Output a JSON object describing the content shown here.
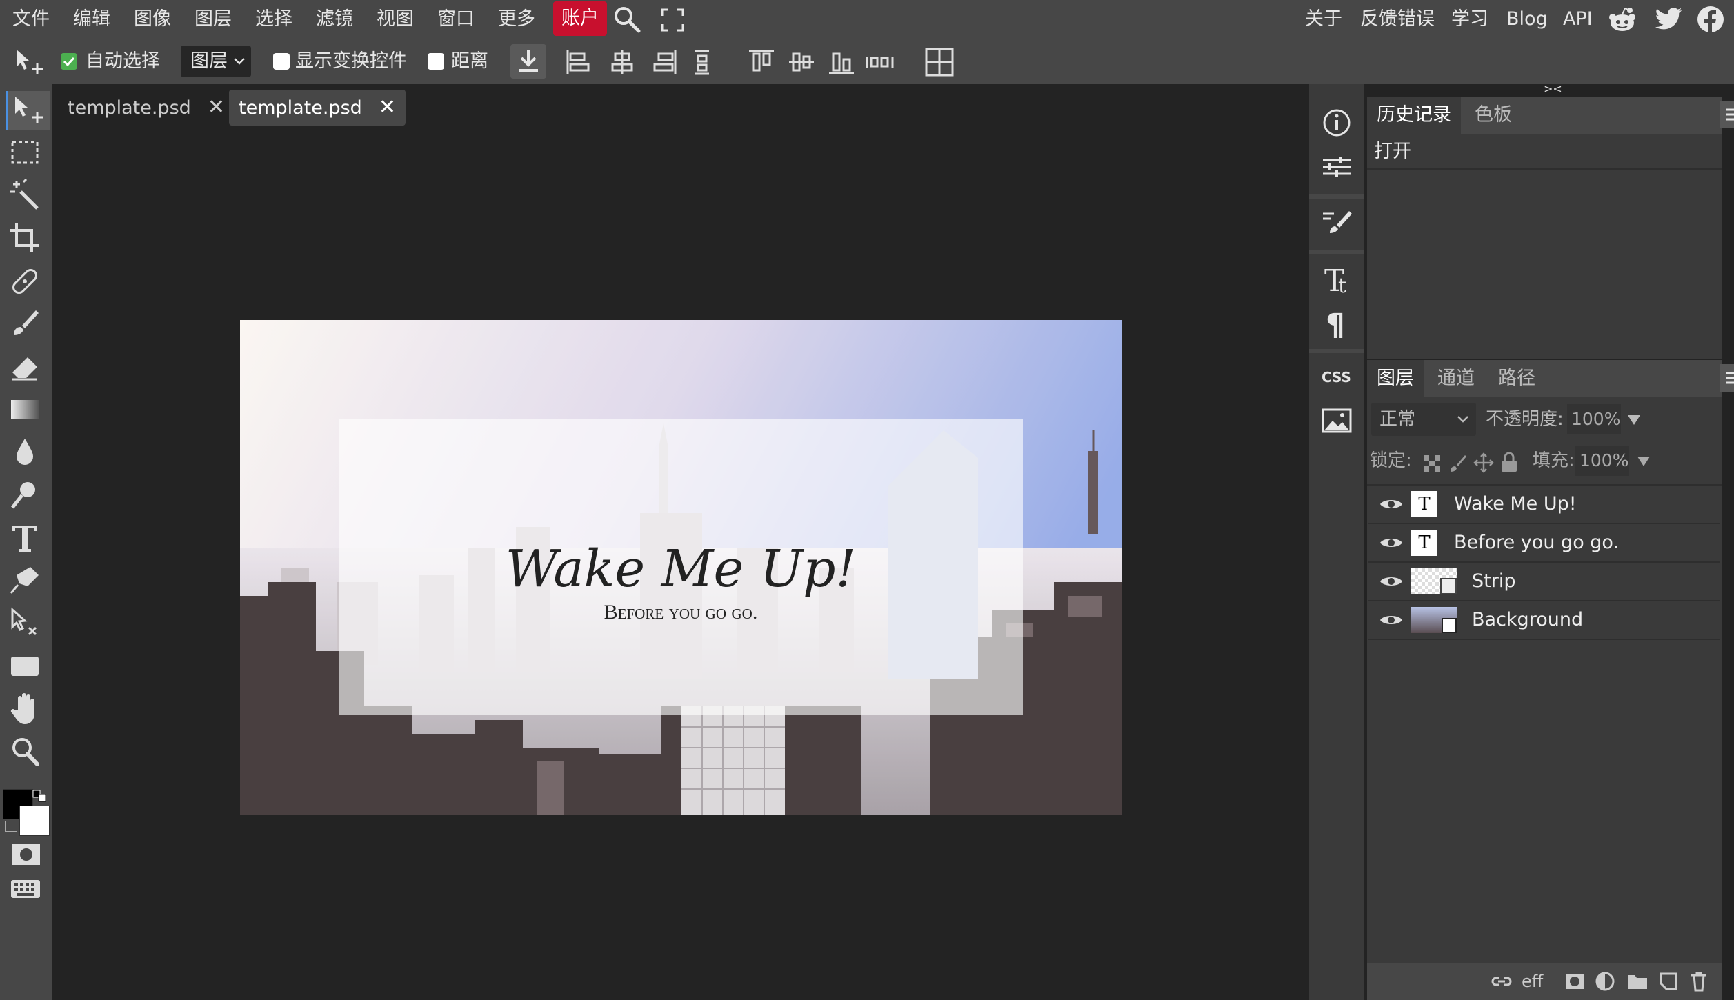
{
  "menubar": {
    "items": [
      "文件",
      "编辑",
      "图像",
      "图层",
      "选择",
      "滤镜",
      "视图",
      "窗口",
      "更多"
    ],
    "account": "账户",
    "right_links": [
      "关于",
      "反馈错误",
      "学习",
      "Blog",
      "API"
    ]
  },
  "toolbar": {
    "auto_select_label": "自动选择",
    "auto_select_checked": true,
    "layer_select_value": "图层",
    "show_transform_label": "显示变换控件",
    "distance_label": "距离"
  },
  "tabs": [
    {
      "title": "template.psd",
      "active": false
    },
    {
      "title": "template.psd",
      "active": true
    }
  ],
  "canvas": {
    "headline": "Wake Me Up!",
    "subline": "Before you go go."
  },
  "history_panel": {
    "tabs": [
      "历史记录",
      "色板"
    ],
    "entries": [
      "打开"
    ]
  },
  "layers_panel": {
    "tabs": [
      "图层",
      "通道",
      "路径"
    ],
    "blend_mode": "正常",
    "opacity_label": "不透明度:",
    "opacity_value": "100%",
    "lock_label": "锁定:",
    "fill_label": "填充:",
    "fill_value": "100%",
    "layers": [
      {
        "name": "Wake Me Up!",
        "kind": "text"
      },
      {
        "name": "Before you go go.",
        "kind": "text"
      },
      {
        "name": "Strip",
        "kind": "raster"
      },
      {
        "name": "Background",
        "kind": "image"
      }
    ],
    "footer_eff": "eff"
  },
  "colors": {
    "accent": "#c8102e",
    "selection": "#4a90e2",
    "foreground": "#000000",
    "background": "#ffffff"
  }
}
